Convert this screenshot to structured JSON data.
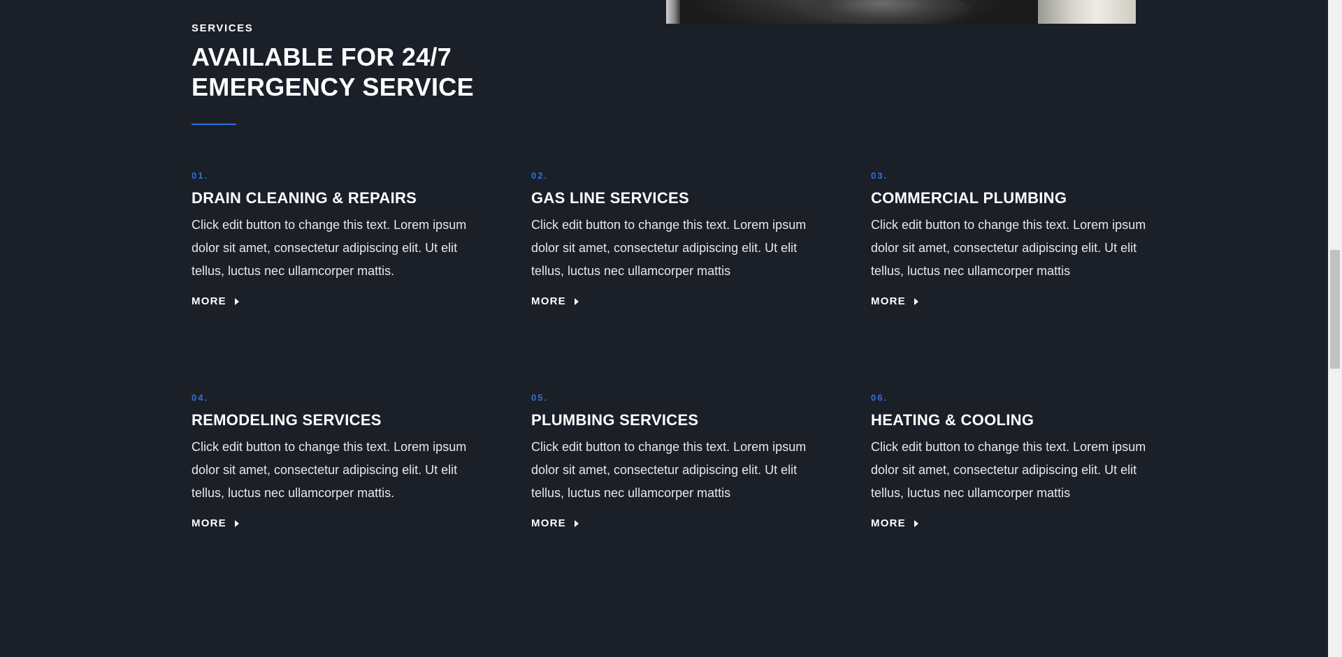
{
  "section": {
    "label": "SERVICES",
    "title": "AVAILABLE FOR 24/7 EMERGENCY SERVICE"
  },
  "services": [
    {
      "num": "01.",
      "title": "DRAIN CLEANING & REPAIRS",
      "desc": "Click edit button to change this text. Lorem ipsum dolor sit amet, consectetur adipiscing elit. Ut elit tellus, luctus nec ullamcorper mattis.",
      "more": "MORE"
    },
    {
      "num": "02.",
      "title": "GAS LINE SERVICES",
      "desc": "Click edit button to change this text. Lorem ipsum dolor sit amet, consectetur adipiscing elit. Ut elit tellus, luctus nec ullamcorper mattis",
      "more": "MORE"
    },
    {
      "num": "03.",
      "title": "COMMERCIAL PLUMBING",
      "desc": "Click edit button to change this text. Lorem ipsum dolor sit amet, consectetur adipiscing elit. Ut elit tellus, luctus nec ullamcorper mattis",
      "more": "MORE"
    },
    {
      "num": "04.",
      "title": "REMODELING SERVICES",
      "desc": "Click edit button to change this text. Lorem ipsum dolor sit amet, consectetur adipiscing elit. Ut elit tellus, luctus nec ullamcorper mattis.",
      "more": "MORE"
    },
    {
      "num": "05.",
      "title": "PLUMBING SERVICES",
      "desc": "Click edit button to change this text. Lorem ipsum dolor sit amet, consectetur adipiscing elit. Ut elit tellus, luctus nec ullamcorper mattis",
      "more": "MORE"
    },
    {
      "num": "06.",
      "title": "HEATING & COOLING",
      "desc": "Click edit button to change this text. Lorem ipsum dolor sit amet, consectetur adipiscing elit. Ut elit tellus, luctus nec ullamcorper mattis",
      "more": "MORE"
    }
  ],
  "icons": {
    "more_arrow": "caret-right-icon"
  },
  "colors": {
    "background": "#1a1f28",
    "accent": "#2f6fe4",
    "text": "#ffffff"
  }
}
